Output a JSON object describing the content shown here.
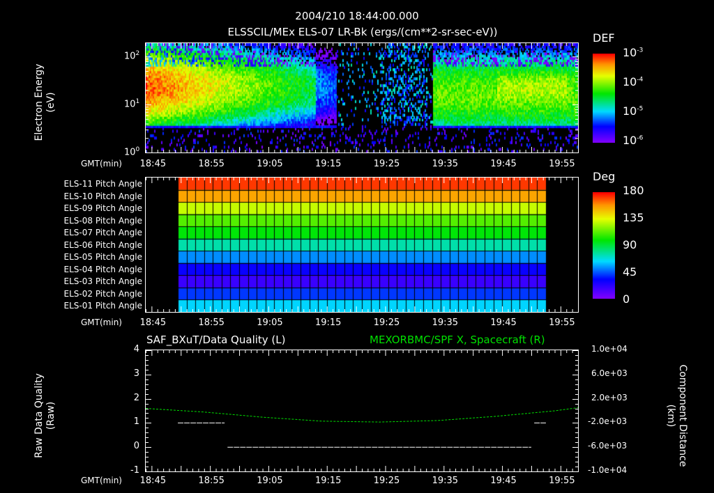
{
  "header": {
    "timestamp": "2004/210 18:44:00.000",
    "title": "ELSSCIL/MEx ELS-07 LR-Bk  (ergs/(cm**2-sr-sec-eV))"
  },
  "time_axis": {
    "label": "GMT(min)",
    "ticks": [
      "18:45",
      "18:55",
      "19:05",
      "19:15",
      "19:25",
      "19:35",
      "19:45",
      "19:55"
    ],
    "start_min": 0,
    "end_min": 74,
    "tick_offsets_min": [
      1,
      11,
      21,
      31,
      41,
      51,
      61,
      71
    ]
  },
  "chart_data": [
    {
      "type": "heatmap",
      "title": "ELSSCIL/MEx ELS-07 LR-Bk  (ergs/(cm**2-sr-sec-eV))",
      "ylabel": "Electron Energy",
      "yunit": "(eV)",
      "yscale": "log",
      "ylim": [
        1,
        190
      ],
      "yticks": [
        {
          "base": "10",
          "exp": "0"
        },
        {
          "base": "10",
          "exp": "1"
        },
        {
          "base": "10",
          "exp": "2"
        }
      ],
      "colorbar": {
        "label": "DEF",
        "range_log10": [
          -6,
          -3
        ],
        "ticks": [
          {
            "base": "10",
            "exp": "-3"
          },
          {
            "base": "10",
            "exp": "-4"
          },
          {
            "base": "10",
            "exp": "-5"
          },
          {
            "base": "10",
            "exp": "-6"
          }
        ]
      },
      "plasma_intervals_min": [
        [
          0,
          32.5
        ],
        [
          49,
          74
        ]
      ],
      "dropout_interval_min": [
        32.5,
        49
      ],
      "low_energy_cutoff_ev": 3.5
    },
    {
      "type": "heatmap",
      "colorbar": {
        "label": "Deg",
        "range": [
          0,
          180
        ],
        "ticks": [
          "180",
          "135",
          "90",
          "45",
          "0"
        ]
      },
      "data_interval_min": [
        5.5,
        68.6
      ],
      "rows": [
        {
          "label": "ELS-11 Pitch Angle",
          "value": 172
        },
        {
          "label": "ELS-10 Pitch Angle",
          "value": 155
        },
        {
          "label": "ELS-09 Pitch Angle",
          "value": 130
        },
        {
          "label": "ELS-08 Pitch Angle",
          "value": 112
        },
        {
          "label": "ELS-07 Pitch Angle",
          "value": 98
        },
        {
          "label": "ELS-06 Pitch Angle",
          "value": 75
        },
        {
          "label": "ELS-05 Pitch Angle",
          "value": 52
        },
        {
          "label": "ELS-04 Pitch Angle",
          "value": 30
        },
        {
          "label": "ELS-03 Pitch Angle",
          "value": 18
        },
        {
          "label": "ELS-02 Pitch Angle",
          "value": 40
        },
        {
          "label": "ELS-01 Pitch Angle",
          "value": 62
        }
      ]
    },
    {
      "type": "line",
      "title_left": "SAF_BXuT/Data Quality (L)",
      "title_right": "MEXORBMC/SPF X, Spacecraft (R)",
      "ylabel_left": "Raw Data Quality",
      "ylabel_left_unit": "(Raw)",
      "ylabel_right": "Component Distance",
      "ylabel_right_unit": "(km)",
      "ylim_left": [
        -1,
        4
      ],
      "yticks_left": [
        "4",
        "3",
        "2",
        "1",
        "0",
        "-1"
      ],
      "ylim_right": [
        -10000,
        10000
      ],
      "yticks_right": [
        "1.0e+04",
        "6.0e+03",
        "2.0e+03",
        "-2.0e+03",
        "-6.0e+03",
        "-1.0e+04"
      ],
      "quality_segments": [
        {
          "x": [
            5.5,
            13.5
          ],
          "y": 1
        },
        {
          "x": [
            14,
            66
          ],
          "y": 0
        },
        {
          "x": [
            66.5,
            68.5
          ],
          "y": 1
        }
      ],
      "spacecraft_x_km": {
        "x": [
          0,
          10,
          20,
          30,
          40,
          50,
          60,
          70,
          74
        ],
        "y": [
          400,
          -200,
          -1050,
          -1700,
          -1850,
          -1600,
          -900,
          0,
          520
        ]
      },
      "colors": {
        "quality": "#ffffff",
        "spacecraft": "#00e000"
      }
    }
  ]
}
